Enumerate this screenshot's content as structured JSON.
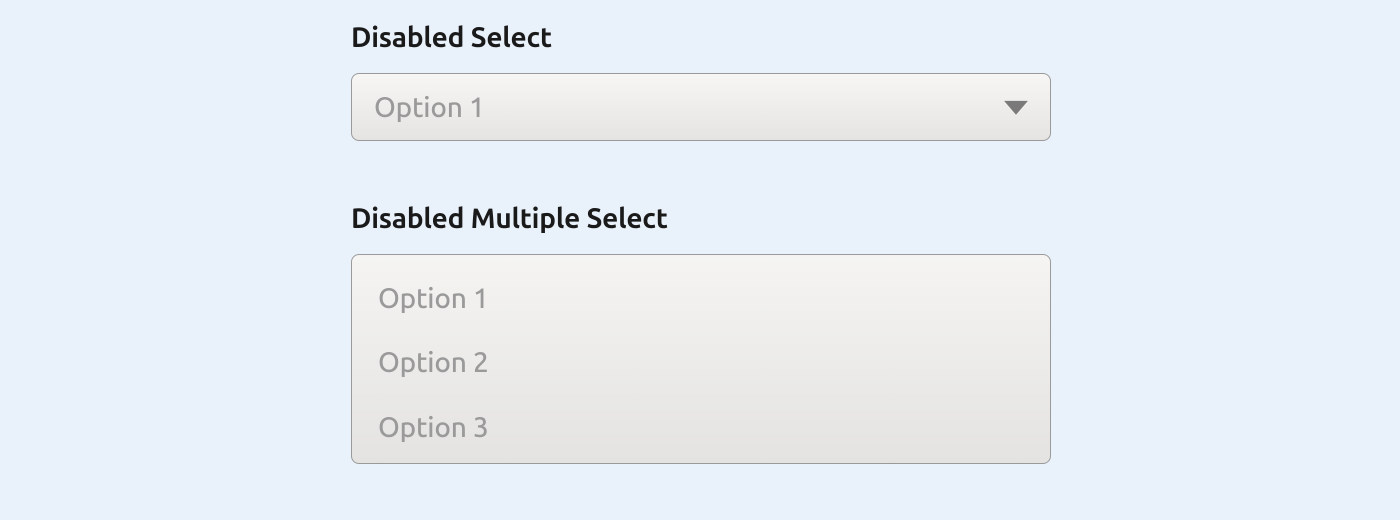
{
  "singleSelect": {
    "label": "Disabled Select",
    "value": "Option 1"
  },
  "multipleSelect": {
    "label": "Disabled Multiple Select",
    "options": [
      "Option 1",
      "Option 2",
      "Option 3"
    ]
  },
  "colors": {
    "pageBg": "#e9f1fa",
    "disabledText": "#9a9a9a",
    "border": "#9a9a9a",
    "labelText": "#1a1a1a"
  }
}
